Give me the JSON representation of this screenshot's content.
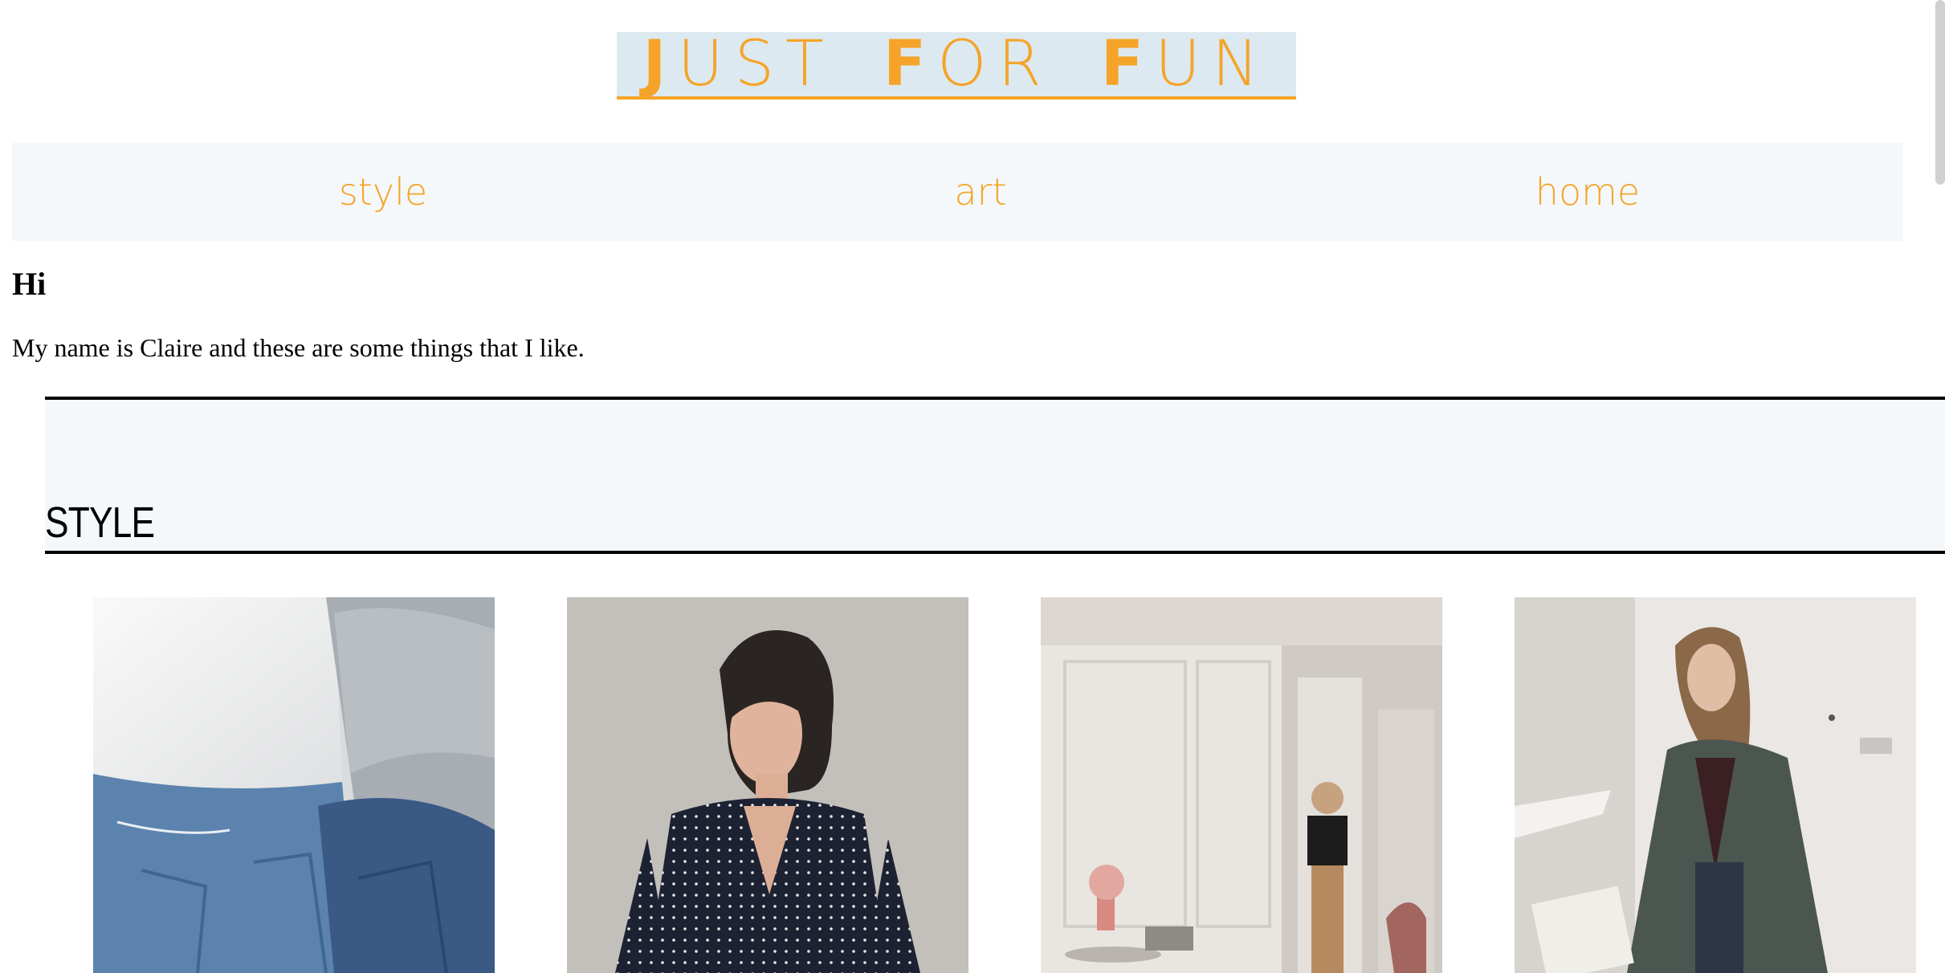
{
  "header": {
    "title_words": [
      {
        "cap": "J",
        "rest": "UST"
      },
      {
        "cap": "F",
        "rest": "OR"
      },
      {
        "cap": "F",
        "rest": "UN"
      }
    ],
    "accent_color": "#f5a429"
  },
  "nav": {
    "items": [
      {
        "label": "style"
      },
      {
        "label": "art"
      },
      {
        "label": "home"
      }
    ]
  },
  "intro": {
    "heading": "Hi",
    "text": "My name is Claire and these are some things that I like."
  },
  "section": {
    "title": "STYLE"
  },
  "gallery": {
    "photos": [
      {
        "icon": "jeans-back-photo"
      },
      {
        "icon": "polka-dot-blouse-photo"
      },
      {
        "icon": "apartment-interior-photo"
      },
      {
        "icon": "grey-coat-photo"
      }
    ]
  }
}
